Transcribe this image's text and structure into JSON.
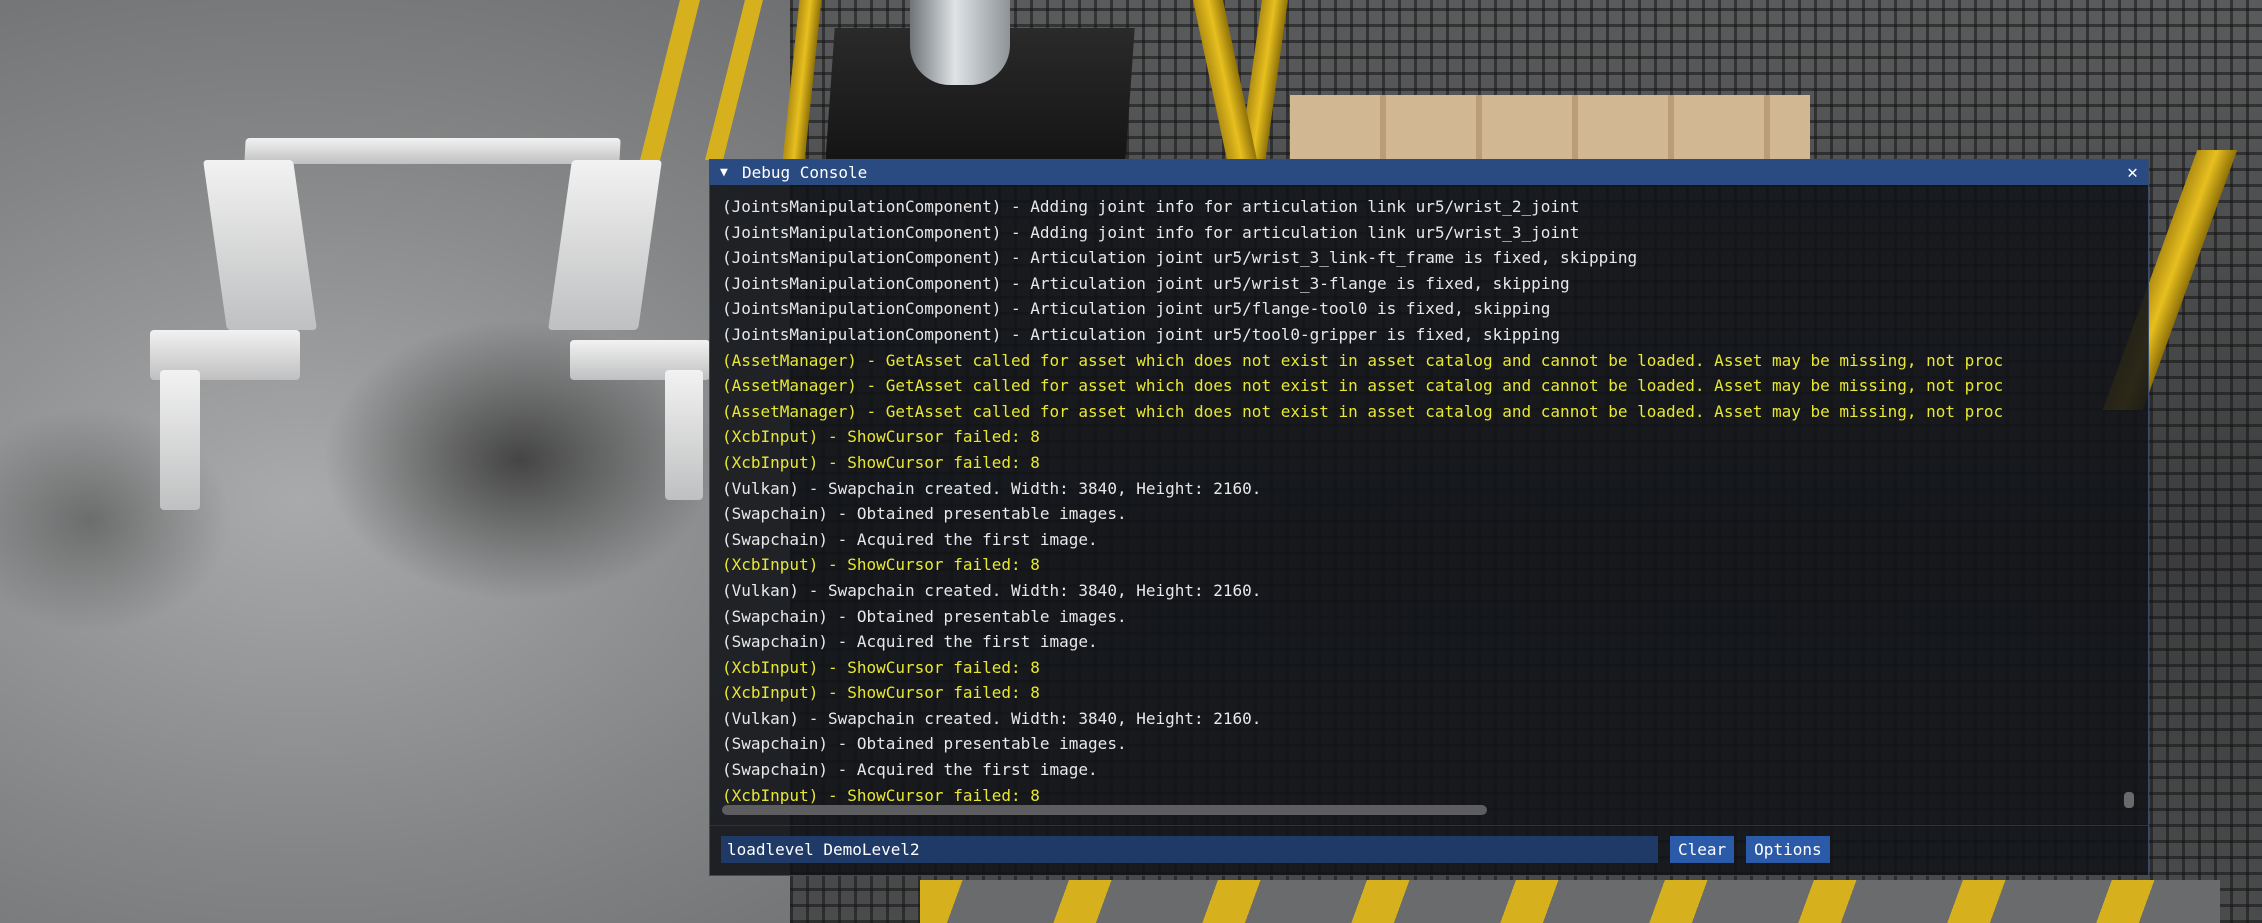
{
  "console": {
    "title": "Debug Console",
    "collapse_icon": "▼",
    "close_icon": "✕",
    "log_lines": [
      {
        "text": "(JointsManipulationComponent) - Adding joint info for articulation link ur5/wrist_2_joint",
        "level": "info"
      },
      {
        "text": "(JointsManipulationComponent) - Adding joint info for articulation link ur5/wrist_3_joint",
        "level": "info"
      },
      {
        "text": "(JointsManipulationComponent) - Articulation joint ur5/wrist_3_link-ft_frame is fixed, skipping",
        "level": "info"
      },
      {
        "text": "(JointsManipulationComponent) - Articulation joint ur5/wrist_3-flange is fixed, skipping",
        "level": "info"
      },
      {
        "text": "(JointsManipulationComponent) - Articulation joint ur5/flange-tool0 is fixed, skipping",
        "level": "info"
      },
      {
        "text": "(JointsManipulationComponent) - Articulation joint ur5/tool0-gripper is fixed, skipping",
        "level": "info"
      },
      {
        "text": "(AssetManager) - GetAsset called for asset which does not exist in asset catalog and cannot be loaded. Asset may be missing, not proc",
        "level": "warn"
      },
      {
        "text": "(AssetManager) - GetAsset called for asset which does not exist in asset catalog and cannot be loaded. Asset may be missing, not proc",
        "level": "warn"
      },
      {
        "text": "(AssetManager) - GetAsset called for asset which does not exist in asset catalog and cannot be loaded. Asset may be missing, not proc",
        "level": "warn"
      },
      {
        "text": "(XcbInput) - ShowCursor failed: 8",
        "level": "warn"
      },
      {
        "text": "(XcbInput) - ShowCursor failed: 8",
        "level": "warn"
      },
      {
        "text": "(Vulkan) - Swapchain created. Width: 3840, Height: 2160.",
        "level": "info"
      },
      {
        "text": "(Swapchain) - Obtained presentable images.",
        "level": "info"
      },
      {
        "text": "(Swapchain) - Acquired the first image.",
        "level": "info"
      },
      {
        "text": "(XcbInput) - ShowCursor failed: 8",
        "level": "warn"
      },
      {
        "text": "(Vulkan) - Swapchain created. Width: 3840, Height: 2160.",
        "level": "info"
      },
      {
        "text": "(Swapchain) - Obtained presentable images.",
        "level": "info"
      },
      {
        "text": "(Swapchain) - Acquired the first image.",
        "level": "info"
      },
      {
        "text": "(XcbInput) - ShowCursor failed: 8",
        "level": "warn"
      },
      {
        "text": "(XcbInput) - ShowCursor failed: 8",
        "level": "warn"
      },
      {
        "text": "(Vulkan) - Swapchain created. Width: 3840, Height: 2160.",
        "level": "info"
      },
      {
        "text": "(Swapchain) - Obtained presentable images.",
        "level": "info"
      },
      {
        "text": "(Swapchain) - Acquired the first image.",
        "level": "info"
      },
      {
        "text": "(XcbInput) - ShowCursor failed: 8",
        "level": "warn"
      }
    ],
    "command_input": {
      "value": "loadlevel DemoLevel2"
    },
    "buttons": {
      "clear_label": "Clear",
      "options_label": "Options"
    },
    "colors": {
      "info": "#e8e8e8",
      "warn": "#e8e833",
      "titlebar": "#2a4a82",
      "button": "#2a5aa8"
    }
  }
}
